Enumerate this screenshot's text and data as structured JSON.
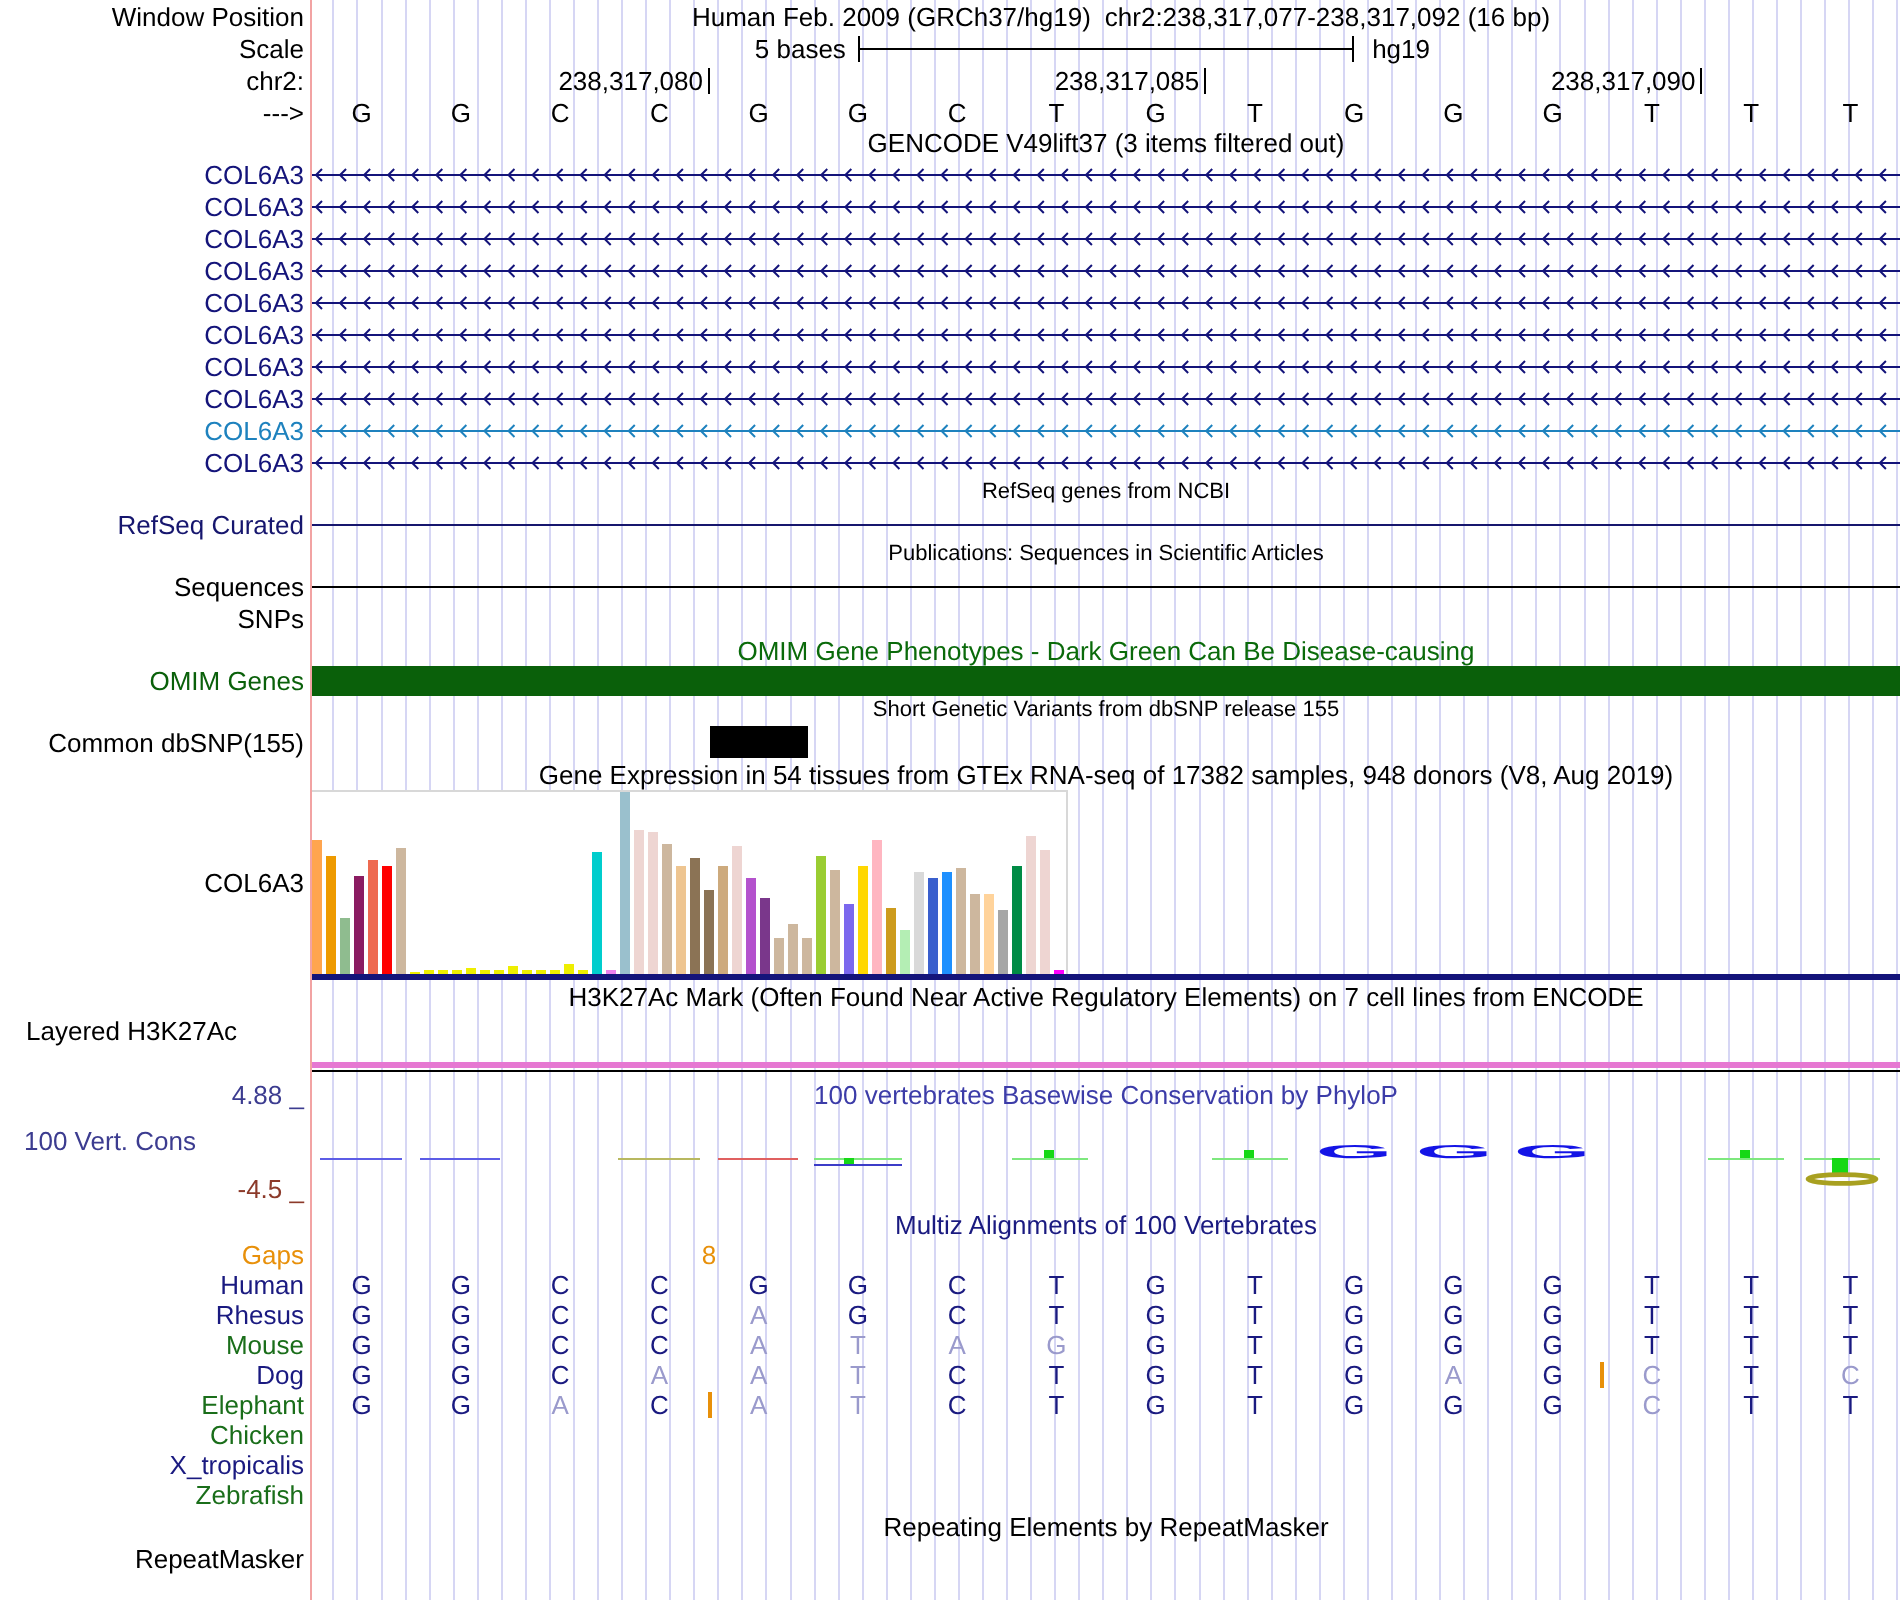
{
  "header": {
    "window_position": {
      "label": "Window Position",
      "assembly": "Human Feb. 2009 (GRCh37/hg19)",
      "range": "chr2:238,317,077-238,317,092 (16 bp)"
    },
    "scale": {
      "label": "Scale",
      "length": "5 bases",
      "assembly": "hg19"
    },
    "ruler": {
      "label": "chr2:"
    },
    "sequence": {
      "label": "--->",
      "bases": [
        {
          "base": "G"
        },
        {
          "base": "G"
        },
        {
          "base": "C"
        },
        {
          "base": "C",
          "tick": "238,317,080"
        },
        {
          "base": "G"
        },
        {
          "base": "G"
        },
        {
          "base": "C"
        },
        {
          "base": "T"
        },
        {
          "base": "G",
          "tick": "238,317,085"
        },
        {
          "base": "T"
        },
        {
          "base": "G"
        },
        {
          "base": "G"
        },
        {
          "base": "G"
        },
        {
          "base": "T",
          "tick": "238,317,090"
        },
        {
          "base": "T"
        },
        {
          "base": "T"
        }
      ]
    }
  },
  "tracks": [
    {
      "kind": "genes",
      "title": {
        "text": "GENCODE V49lift37 (3 items filtered out)",
        "color": "#000000",
        "kind": "heading"
      },
      "items": [
        {
          "label": "COL6A3",
          "color": "#14147a",
          "reverse_strand": true
        },
        {
          "label": "COL6A3",
          "color": "#14147a",
          "reverse_strand": true
        },
        {
          "label": "COL6A3",
          "color": "#14147a",
          "reverse_strand": true
        },
        {
          "label": "COL6A3",
          "color": "#14147a",
          "reverse_strand": true
        },
        {
          "label": "COL6A3",
          "color": "#14147a",
          "reverse_strand": true
        },
        {
          "label": "COL6A3",
          "color": "#14147a",
          "reverse_strand": true
        },
        {
          "label": "COL6A3",
          "color": "#14147a",
          "reverse_strand": true
        },
        {
          "label": "COL6A3",
          "color": "#14147a",
          "reverse_strand": true
        },
        {
          "label": "COL6A3",
          "color": "#1e82be",
          "reverse_strand": true
        },
        {
          "label": "COL6A3",
          "color": "#14147a",
          "reverse_strand": true
        }
      ]
    },
    {
      "kind": "line",
      "title": {
        "text": "RefSeq genes from NCBI",
        "color": "#000000",
        "kind": "note"
      },
      "label": "RefSeq Curated",
      "color": "#16166e"
    },
    {
      "kind": "line",
      "title": {
        "text": "Publications: Sequences in Scientific Articles",
        "color": "#000000",
        "kind": "note"
      },
      "label": "Sequences",
      "color": "#000000"
    },
    {
      "kind": "empty",
      "label": "SNPs",
      "color": "#000000"
    },
    {
      "kind": "bar",
      "title": {
        "text": "OMIM Gene Phenotypes - Dark Green Can Be Disease-causing",
        "color": "#0a6a0a",
        "kind": "heading"
      },
      "label": "OMIM Genes",
      "color": "#0a600a"
    },
    {
      "kind": "variants",
      "title": {
        "text": "Short Genetic Variants from dbSNP release 155",
        "color": "#000000",
        "kind": "note"
      },
      "label": "Common dbSNP(155)",
      "color": "#000000",
      "cells": [
        {
          "variant": false
        },
        {
          "variant": false
        },
        {
          "variant": false
        },
        {
          "variant": false
        },
        {
          "variant": true
        },
        {
          "variant": false
        },
        {
          "variant": false
        },
        {
          "variant": false
        },
        {
          "variant": false
        },
        {
          "variant": false
        },
        {
          "variant": false
        },
        {
          "variant": false
        },
        {
          "variant": false
        },
        {
          "variant": false
        },
        {
          "variant": false
        },
        {
          "variant": false
        }
      ]
    },
    {
      "kind": "expression",
      "title": {
        "text": "Gene Expression in 54 tissues from GTEx RNA-seq of 17382 samples, 948 donors (V8, Aug 2019)",
        "color": "#000000",
        "kind": "heading"
      },
      "label": "COL6A3",
      "color": "#000000"
    },
    {
      "kind": "signal",
      "title": {
        "text": "H3K27Ac Mark (Often Found Near Active Regulatory Elements) on 7 cell lines from ENCODE",
        "color": "#000000",
        "kind": "heading"
      },
      "label": "Layered H3K27Ac",
      "color": "#000000"
    },
    {
      "kind": "conservation",
      "title": {
        "text": "100 vertebrates Basewise Conservation by PhyloP",
        "color": "#3c3ca8",
        "kind": "heading"
      },
      "label": "100 Vert. Cons",
      "color": "#3c3c90",
      "axis": [
        {
          "text": "4.88 _",
          "color": "#3c3c90"
        },
        {
          "text": "-4.5 _",
          "color": "#8c3a2a"
        }
      ],
      "cells": [
        {
          "kind": "line",
          "color": "#5c5ce6"
        },
        {
          "kind": "line",
          "color": "#5c5ce6"
        },
        {
          "kind": "none"
        },
        {
          "kind": "line",
          "color": "#b8b860"
        },
        {
          "kind": "line",
          "color": "#e06060"
        },
        {
          "kind": "double"
        },
        {
          "kind": "none"
        },
        {
          "kind": "tick"
        },
        {
          "kind": "none"
        },
        {
          "kind": "tick"
        },
        {
          "kind": "letter",
          "text": "G",
          "color": "#1414e6"
        },
        {
          "kind": "letter",
          "text": "G",
          "color": "#1414e6"
        },
        {
          "kind": "letter",
          "text": "G",
          "color": "#1414e6"
        },
        {
          "kind": "none"
        },
        {
          "kind": "tick"
        },
        {
          "kind": "dip"
        }
      ]
    },
    {
      "kind": "alignment",
      "title": {
        "text": "Multiz Alignments of 100 Vertebrates",
        "color": "#1a1a80",
        "kind": "heading"
      },
      "rows": [
        {
          "kind": "gaps",
          "label": "Gaps",
          "color": "#e8900a",
          "cells": [
            {
              "insert": false
            },
            {
              "insert": false
            },
            {
              "insert": false
            },
            {
              "insert": false
            },
            {
              "insert": true,
              "text": "8"
            },
            {
              "insert": false
            },
            {
              "insert": false
            },
            {
              "insert": false
            },
            {
              "insert": false
            },
            {
              "insert": false
            },
            {
              "insert": false
            },
            {
              "insert": false
            },
            {
              "insert": false
            },
            {
              "insert": false
            },
            {
              "insert": false
            },
            {
              "insert": false
            }
          ]
        },
        {
          "kind": "bases",
          "label": "Human",
          "color": "#1a1a80",
          "cells": [
            {
              "base": "G",
              "match": true,
              "insert": false
            },
            {
              "base": "G",
              "match": true,
              "insert": false
            },
            {
              "base": "C",
              "match": true,
              "insert": false
            },
            {
              "base": "C",
              "match": true,
              "insert": false
            },
            {
              "base": "G",
              "match": true,
              "insert": false
            },
            {
              "base": "G",
              "match": true,
              "insert": false
            },
            {
              "base": "C",
              "match": true,
              "insert": false
            },
            {
              "base": "T",
              "match": true,
              "insert": false
            },
            {
              "base": "G",
              "match": true,
              "insert": false
            },
            {
              "base": "T",
              "match": true,
              "insert": false
            },
            {
              "base": "G",
              "match": true,
              "insert": false
            },
            {
              "base": "G",
              "match": true,
              "insert": false
            },
            {
              "base": "G",
              "match": true,
              "insert": false
            },
            {
              "base": "T",
              "match": true,
              "insert": false
            },
            {
              "base": "T",
              "match": true,
              "insert": false
            },
            {
              "base": "T",
              "match": true,
              "insert": false
            }
          ]
        },
        {
          "kind": "bases",
          "label": "Rhesus",
          "color": "#1a1a80",
          "cells": [
            {
              "base": "G",
              "match": true,
              "insert": false
            },
            {
              "base": "G",
              "match": true,
              "insert": false
            },
            {
              "base": "C",
              "match": true,
              "insert": false
            },
            {
              "base": "C",
              "match": true,
              "insert": false
            },
            {
              "base": "A",
              "match": false,
              "insert": false
            },
            {
              "base": "G",
              "match": true,
              "insert": false
            },
            {
              "base": "C",
              "match": true,
              "insert": false
            },
            {
              "base": "T",
              "match": true,
              "insert": false
            },
            {
              "base": "G",
              "match": true,
              "insert": false
            },
            {
              "base": "T",
              "match": true,
              "insert": false
            },
            {
              "base": "G",
              "match": true,
              "insert": false
            },
            {
              "base": "G",
              "match": true,
              "insert": false
            },
            {
              "base": "G",
              "match": true,
              "insert": false
            },
            {
              "base": "T",
              "match": true,
              "insert": false
            },
            {
              "base": "T",
              "match": true,
              "insert": false
            },
            {
              "base": "T",
              "match": true,
              "insert": false
            }
          ]
        },
        {
          "kind": "bases",
          "label": "Mouse",
          "color": "#1a6e1a",
          "cells": [
            {
              "base": "G",
              "match": true,
              "insert": false
            },
            {
              "base": "G",
              "match": true,
              "insert": false
            },
            {
              "base": "C",
              "match": true,
              "insert": false
            },
            {
              "base": "C",
              "match": true,
              "insert": false
            },
            {
              "base": "A",
              "match": false,
              "insert": false
            },
            {
              "base": "T",
              "match": false,
              "insert": false
            },
            {
              "base": "A",
              "match": false,
              "insert": false
            },
            {
              "base": "G",
              "match": false,
              "insert": false
            },
            {
              "base": "G",
              "match": true,
              "insert": false
            },
            {
              "base": "T",
              "match": true,
              "insert": false
            },
            {
              "base": "G",
              "match": true,
              "insert": false
            },
            {
              "base": "G",
              "match": true,
              "insert": false
            },
            {
              "base": "G",
              "match": true,
              "insert": false
            },
            {
              "base": "T",
              "match": true,
              "insert": false
            },
            {
              "base": "T",
              "match": true,
              "insert": false
            },
            {
              "base": "T",
              "match": true,
              "insert": false
            }
          ]
        },
        {
          "kind": "bases",
          "label": "Dog",
          "color": "#1a1a80",
          "cells": [
            {
              "base": "G",
              "match": true,
              "insert": false
            },
            {
              "base": "G",
              "match": true,
              "insert": false
            },
            {
              "base": "C",
              "match": true,
              "insert": false
            },
            {
              "base": "A",
              "match": false,
              "insert": false
            },
            {
              "base": "A",
              "match": false,
              "insert": false
            },
            {
              "base": "T",
              "match": false,
              "insert": false
            },
            {
              "base": "C",
              "match": true,
              "insert": false
            },
            {
              "base": "T",
              "match": true,
              "insert": false
            },
            {
              "base": "G",
              "match": true,
              "insert": false
            },
            {
              "base": "T",
              "match": true,
              "insert": false
            },
            {
              "base": "G",
              "match": true,
              "insert": false
            },
            {
              "base": "A",
              "match": false,
              "insert": false
            },
            {
              "base": "G",
              "match": true,
              "insert": false
            },
            {
              "base": "C",
              "match": false,
              "insert": true
            },
            {
              "base": "T",
              "match": true,
              "insert": false
            },
            {
              "base": "C",
              "match": false,
              "insert": false
            }
          ]
        },
        {
          "kind": "bases",
          "label": "Elephant",
          "color": "#1a6e1a",
          "cells": [
            {
              "base": "G",
              "match": true,
              "insert": false
            },
            {
              "base": "G",
              "match": true,
              "insert": false
            },
            {
              "base": "A",
              "match": false,
              "insert": false
            },
            {
              "base": "C",
              "match": true,
              "insert": false
            },
            {
              "base": "A",
              "match": false,
              "insert": true
            },
            {
              "base": "T",
              "match": false,
              "insert": false
            },
            {
              "base": "C",
              "match": true,
              "insert": false
            },
            {
              "base": "T",
              "match": true,
              "insert": false
            },
            {
              "base": "G",
              "match": true,
              "insert": false
            },
            {
              "base": "T",
              "match": true,
              "insert": false
            },
            {
              "base": "G",
              "match": true,
              "insert": false
            },
            {
              "base": "G",
              "match": true,
              "insert": false
            },
            {
              "base": "G",
              "match": true,
              "insert": false
            },
            {
              "base": "C",
              "match": false,
              "insert": false
            },
            {
              "base": "T",
              "match": true,
              "insert": false
            },
            {
              "base": "T",
              "match": true,
              "insert": false
            }
          ]
        },
        {
          "kind": "empty",
          "label": "Chicken",
          "color": "#1a6e1a"
        },
        {
          "kind": "empty",
          "label": "X_tropicalis",
          "color": "#1a1a80"
        },
        {
          "kind": "empty",
          "label": "Zebrafish",
          "color": "#1a6e1a"
        }
      ]
    },
    {
      "kind": "empty",
      "title": {
        "text": "Repeating Elements by RepeatMasker",
        "color": "#000000",
        "kind": "heading"
      },
      "label": "RepeatMasker",
      "color": "#000000"
    }
  ]
}
